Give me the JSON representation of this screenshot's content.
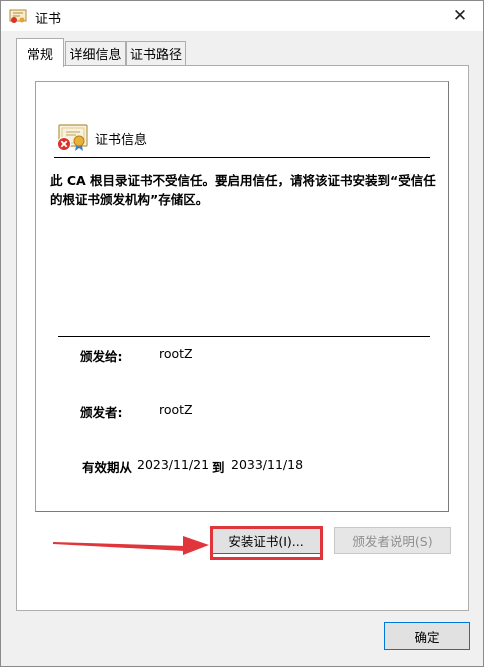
{
  "window": {
    "title": "证书",
    "close_glyph": "✕"
  },
  "tabs": [
    {
      "label": "常规",
      "active": true
    },
    {
      "label": "详细信息",
      "active": false
    },
    {
      "label": "证书路径",
      "active": false
    }
  ],
  "general": {
    "header": "证书信息",
    "warning": "此 CA 根目录证书不受信任。要启用信任，请将该证书安装到“受信任的根证书颁发机构”存储区。",
    "issued_to_label": "颁发给:",
    "issued_to_value": "rootZ",
    "issued_by_label": "颁发者:",
    "issued_by_value": "rootZ",
    "validity_label": "有效期从",
    "valid_from": "2023/11/21",
    "to_label": "到",
    "valid_to": "2033/11/18"
  },
  "buttons": {
    "install": "安装证书(I)...",
    "issuer_statement": "颁发者说明(S)",
    "ok": "确定"
  },
  "icons": {
    "title": "certificate-icon",
    "cert": "untrusted-certificate-icon",
    "arrow": "red-arrow-icon"
  },
  "colors": {
    "annotation": "#e0353a",
    "primary_border": "#0078d7"
  }
}
